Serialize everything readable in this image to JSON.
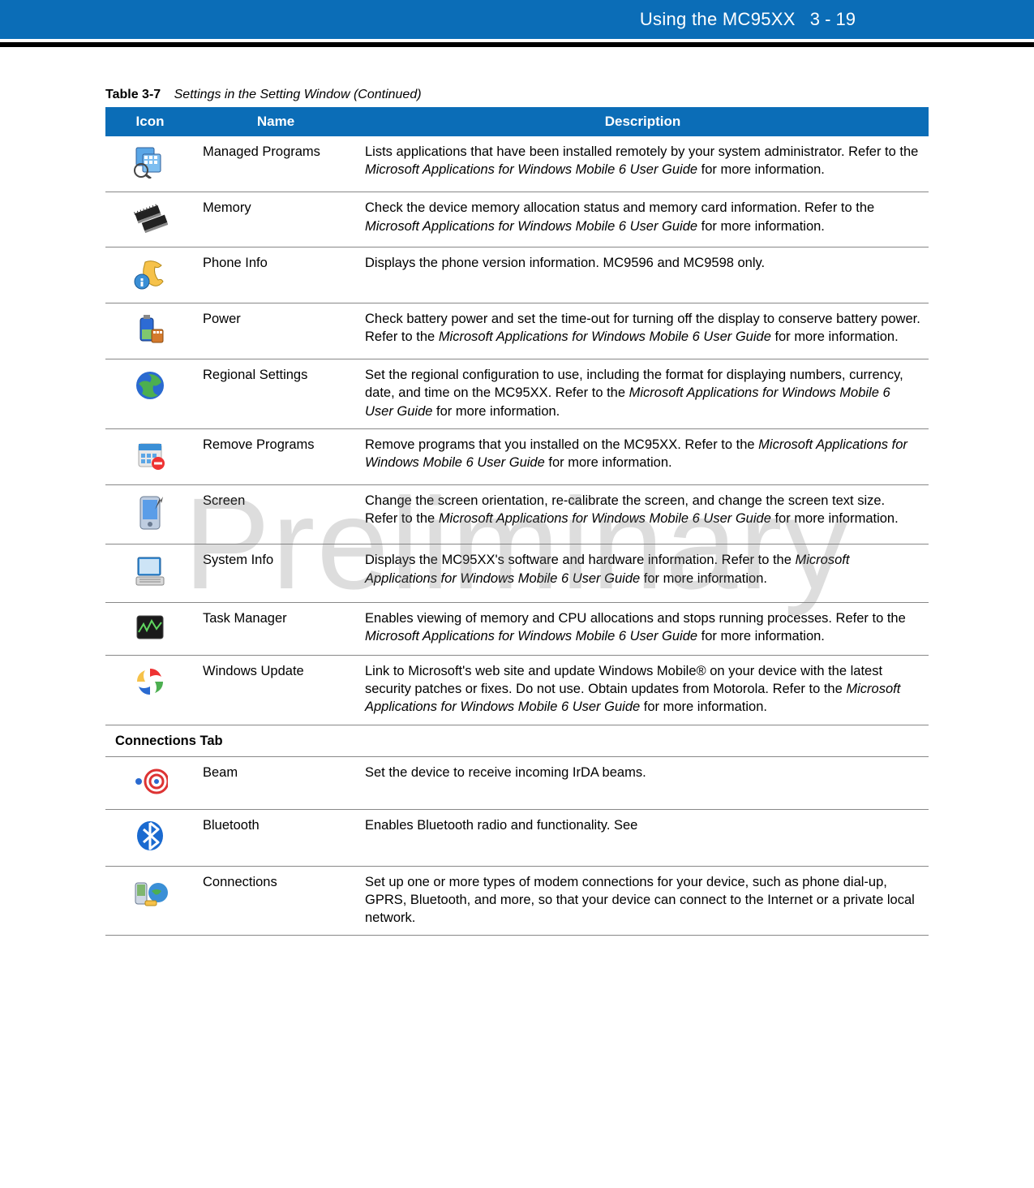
{
  "header": {
    "title": "Using the MC95XX",
    "page": "3 - 19"
  },
  "caption": {
    "label": "Table 3-7",
    "title": "Settings in the Setting Window (Continued)"
  },
  "columns": {
    "icon": "Icon",
    "name": "Name",
    "description": "Description"
  },
  "watermark": "Preliminary",
  "rows": [
    {
      "icon": "managed-programs-icon",
      "name": "Managed Programs",
      "desc_pre": "Lists applications that have been installed remotely by your system administrator. Refer to the ",
      "desc_ital": "Microsoft Applications for Windows Mobile 6 User Guide",
      "desc_post": " for more information."
    },
    {
      "icon": "memory-icon",
      "name": "Memory",
      "desc_pre": "Check the device memory allocation status and memory card information. Refer to the ",
      "desc_ital": "Microsoft Applications for Windows Mobile 6 User Guide",
      "desc_post": " for more information."
    },
    {
      "icon": "phone-info-icon",
      "name": "Phone Info",
      "desc_pre": "Displays the phone version information. MC9596 and MC9598 only.",
      "desc_ital": "",
      "desc_post": ""
    },
    {
      "icon": "power-icon",
      "name": "Power",
      "desc_pre": "Check battery power and set the time-out for turning off the display to conserve battery power. Refer to the ",
      "desc_ital": "Microsoft Applications for Windows Mobile 6 User Guide",
      "desc_post": " for more information."
    },
    {
      "icon": "regional-settings-icon",
      "name": "Regional Settings",
      "desc_pre": "Set the regional configuration to use, including the format for displaying numbers, currency, date, and time on the MC95XX. Refer to the ",
      "desc_ital": "Microsoft Applications for Windows Mobile 6 User Guide",
      "desc_post": " for more information."
    },
    {
      "icon": "remove-programs-icon",
      "name": "Remove Programs",
      "desc_pre": "Remove programs that you installed on the MC95XX. Refer to the ",
      "desc_ital": "Microsoft Applications for Windows Mobile 6 User Guide",
      "desc_post": " for more information."
    },
    {
      "icon": "screen-icon",
      "name": "Screen",
      "desc_pre": "Change the screen orientation, re-calibrate the screen, and change the screen text size. Refer to the ",
      "desc_ital": "Microsoft Applications for Windows Mobile 6 User Guide",
      "desc_post": " for more information."
    },
    {
      "icon": "system-info-icon",
      "name": "System Info",
      "desc_pre": "Displays the MC95XX's software and hardware information. Refer to the ",
      "desc_ital": "Microsoft Applications for Windows Mobile 6 User Guide",
      "desc_post": " for more information."
    },
    {
      "icon": "task-manager-icon",
      "name": "Task Manager",
      "desc_pre": "Enables viewing of memory and CPU allocations and stops running processes. Refer to the ",
      "desc_ital": "Microsoft Applications for Windows Mobile 6 User Guide",
      "desc_post": " for more information."
    },
    {
      "icon": "windows-update-icon",
      "name": "Windows Update",
      "desc_pre": "Link to Microsoft's web site and update Windows Mobile® on your device with the latest security patches or fixes. Do not use. Obtain updates from Motorola. Refer to the ",
      "desc_ital": "Microsoft Applications for Windows Mobile 6 User Guide",
      "desc_post": " for more information."
    }
  ],
  "section2": "Connections Tab",
  "rows2": [
    {
      "icon": "beam-icon",
      "name": "Beam",
      "desc_pre": "Set the device to receive incoming IrDA beams.",
      "desc_ital": "",
      "desc_post": ""
    },
    {
      "icon": "bluetooth-icon",
      "name": "Bluetooth",
      "desc_pre": "Enables Bluetooth radio and functionality. See",
      "desc_ital": "",
      "desc_post": ""
    },
    {
      "icon": "connections-icon",
      "name": "Connections",
      "desc_pre": "Set up one or more types of modem connections for your device, such as phone dial-up, GPRS, Bluetooth, and more, so that your device can connect to the Internet or a private local network.",
      "desc_ital": "",
      "desc_post": ""
    }
  ]
}
